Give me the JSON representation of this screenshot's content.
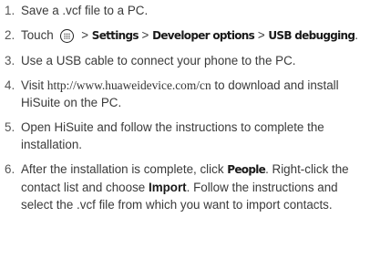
{
  "steps": [
    {
      "number": "1.",
      "text": "Save a .vcf file to a PC."
    },
    {
      "number": "2.",
      "prefix": "Touch",
      "icon": "menu-icon",
      "sep": ">",
      "settings": "Settings",
      "developer_options": "Developer options",
      "usb_debugging": "USB debugging",
      "end": "."
    },
    {
      "number": "3.",
      "text": "Use a USB cable to connect your phone to the PC."
    },
    {
      "number": "4.",
      "prefix": "Visit",
      "url": "http://www.huaweidevice.com/cn",
      "suffix": "to download and install HiSuite on the PC."
    },
    {
      "number": "5.",
      "text": "Open HiSuite and follow the instructions to complete the installation."
    },
    {
      "number": "6.",
      "part1": "After the installation is complete, click",
      "people": "People",
      "part2": ". Right-click the contact list and choose",
      "import": "Import",
      "part3": ". Follow the instructions and select the .vcf file from which you want to import contacts."
    }
  ]
}
